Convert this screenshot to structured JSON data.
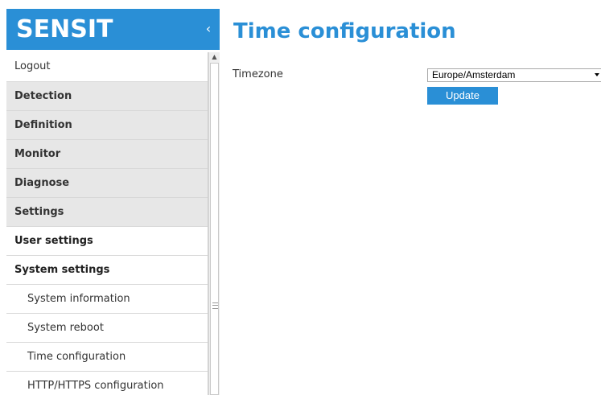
{
  "brand": {
    "name": "SENSIT",
    "collapse_icon": "chevron-left-icon"
  },
  "menu": {
    "items": [
      {
        "label": "Logout"
      },
      {
        "label": "Detection"
      },
      {
        "label": "Definition"
      },
      {
        "label": "Monitor"
      },
      {
        "label": "Diagnose"
      },
      {
        "label": "Settings"
      },
      {
        "label": "User settings"
      },
      {
        "label": "System settings"
      },
      {
        "label": "System information"
      },
      {
        "label": "System reboot"
      },
      {
        "label": "Time configuration"
      },
      {
        "label": "HTTP/HTTPS configuration"
      }
    ]
  },
  "main": {
    "title": "Time configuration",
    "timezone_label": "Timezone",
    "timezone_value": "Europe/Amsterdam",
    "update_label": "Update"
  },
  "colors": {
    "accent": "#2a8fd6",
    "group_bg": "#e7e7e7"
  }
}
